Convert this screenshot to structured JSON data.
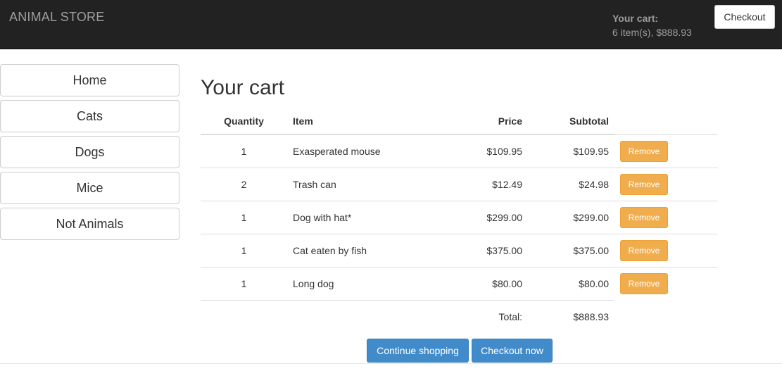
{
  "navbar": {
    "brand": "ANIMAL STORE",
    "cart_label": "Your cart:",
    "cart_info": "6 item(s), $888.93",
    "checkout_label": "Checkout"
  },
  "sidebar": {
    "items": [
      {
        "label": "Home"
      },
      {
        "label": "Cats"
      },
      {
        "label": "Dogs"
      },
      {
        "label": "Mice"
      },
      {
        "label": "Not Animals"
      }
    ]
  },
  "cart": {
    "title": "Your cart",
    "columns": {
      "quantity": "Quantity",
      "item": "Item",
      "price": "Price",
      "subtotal": "Subtotal"
    },
    "rows": [
      {
        "qty": "1",
        "item": "Exasperated mouse",
        "price": "$109.95",
        "subtotal": "$109.95",
        "action": "Remove"
      },
      {
        "qty": "2",
        "item": "Trash can",
        "price": "$12.49",
        "subtotal": "$24.98",
        "action": "Remove"
      },
      {
        "qty": "1",
        "item": "Dog with hat*",
        "price": "$299.00",
        "subtotal": "$299.00",
        "action": "Remove"
      },
      {
        "qty": "1",
        "item": "Cat eaten by fish",
        "price": "$375.00",
        "subtotal": "$375.00",
        "action": "Remove"
      },
      {
        "qty": "1",
        "item": "Long dog",
        "price": "$80.00",
        "subtotal": "$80.00",
        "action": "Remove"
      }
    ],
    "total_label": "Total:",
    "total_value": "$888.93"
  },
  "actions": {
    "continue_label": "Continue shopping",
    "checkout_now_label": "Checkout now"
  },
  "colors": {
    "navbar_bg": "#222222",
    "remove_button": "#f0ad4e",
    "primary_button": "#428bca"
  }
}
